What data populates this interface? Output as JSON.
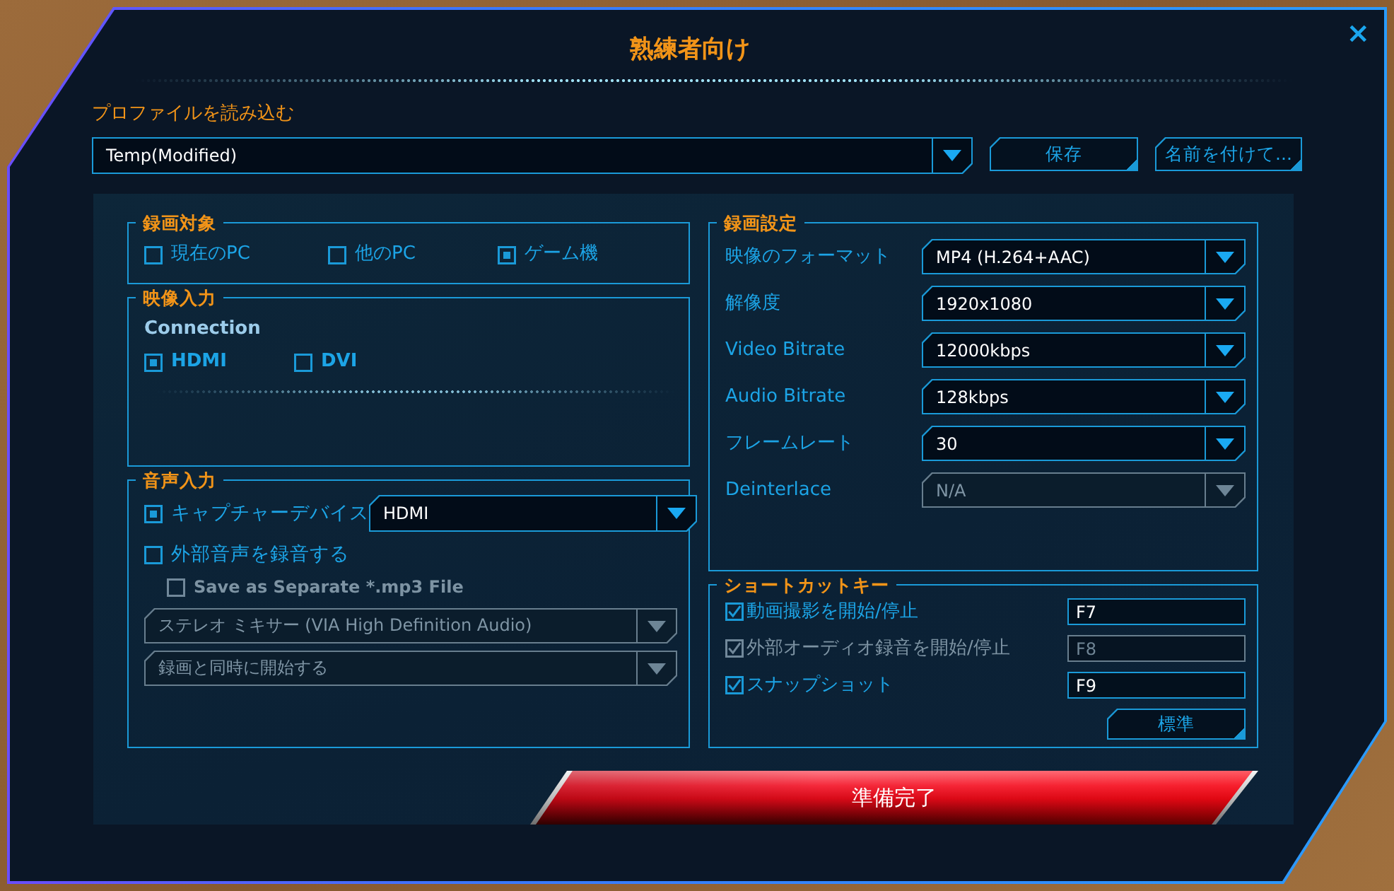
{
  "window": {
    "title": "熟練者向け",
    "close": "×"
  },
  "profile": {
    "label": "プロファイルを読み込む",
    "value": "Temp(Modified)",
    "buttons": [
      "保存",
      "名前を付けて..."
    ]
  },
  "capture_target": {
    "title": "録画対象",
    "options": [
      {
        "label": "現在のPC",
        "selected": false
      },
      {
        "label": "他のPC",
        "selected": false
      },
      {
        "label": "ゲーム機",
        "selected": true
      }
    ]
  },
  "video_input": {
    "title": "映像入力",
    "connection_label": "Connection",
    "options": [
      {
        "label": "HDMI",
        "selected": true
      },
      {
        "label": "DVI",
        "selected": false
      }
    ]
  },
  "audio_input": {
    "title": "音声入力",
    "capture_device": {
      "label": "キャプチャーデバイス",
      "checked": true,
      "value": "HDMI"
    },
    "external_audio": {
      "label": "外部音声を録音する",
      "checked": false
    },
    "save_mp3": {
      "label": "Save as Separate *.mp3 File",
      "checked": false,
      "disabled": true
    },
    "selects": [
      {
        "value": "ステレオ ミキサー (VIA High Definition Audio)",
        "disabled": true
      },
      {
        "value": "録画と同時に開始する",
        "disabled": true
      }
    ]
  },
  "recording_settings": {
    "title": "録画設定",
    "rows": [
      {
        "label": "映像のフォーマット",
        "value": "MP4 (H.264+AAC)",
        "disabled": false
      },
      {
        "label": "解像度",
        "value": "1920x1080",
        "disabled": false
      },
      {
        "label": "Video Bitrate",
        "value": "12000kbps",
        "disabled": false
      },
      {
        "label": "Audio Bitrate",
        "value": "128kbps",
        "disabled": false
      },
      {
        "label": "フレームレート",
        "value": "30",
        "disabled": false
      },
      {
        "label": "Deinterlace",
        "value": "N/A",
        "disabled": true
      }
    ]
  },
  "shortcuts": {
    "title": "ショートカットキー",
    "items": [
      {
        "label": "動画撮影を開始/停止",
        "checked": true,
        "key": "F7",
        "disabled": false
      },
      {
        "label": "外部オーディオ録音を開始/停止",
        "checked": true,
        "key": "F8",
        "disabled": true
      },
      {
        "label": "スナップショット",
        "checked": true,
        "key": "F9",
        "disabled": false
      }
    ],
    "reset_button": "標準"
  },
  "ready_button": "準備完了"
}
